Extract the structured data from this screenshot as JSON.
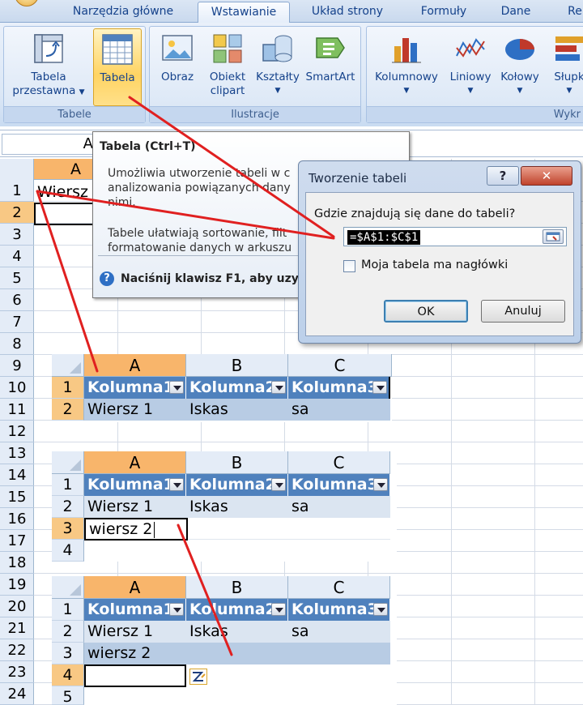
{
  "ribbon": {
    "tabs": [
      "Narzędzia główne",
      "Wstawianie",
      "Układ strony",
      "Formuły",
      "Dane",
      "Re"
    ],
    "active_tab": "Wstawianie",
    "groups": {
      "tabele": {
        "label": "Tabele",
        "pivot_line1": "Tabela",
        "pivot_line2": "przestawna",
        "table": "Tabela"
      },
      "ilustracje": {
        "label": "Ilustracje",
        "picture": "Obraz",
        "clipart_line1": "Obiekt",
        "clipart_line2": "clipart",
        "shapes": "Kształty",
        "smartart": "SmartArt"
      },
      "wykresy": {
        "label": "Wykr",
        "column": "Kolumnowy",
        "line": "Liniowy",
        "pie": "Kołowy",
        "bar": "Słupk"
      }
    }
  },
  "formula_bar": {
    "name_box": "A"
  },
  "sheet": {
    "columns": [
      "A"
    ],
    "row_numbers": [
      "1",
      "2",
      "3",
      "4",
      "5",
      "6",
      "7",
      "8",
      "9",
      "10",
      "11",
      "12",
      "13",
      "14",
      "15",
      "16",
      "17",
      "18",
      "19",
      "20",
      "21",
      "22",
      "23",
      "24"
    ],
    "a1_text": "Wiersz"
  },
  "tooltip": {
    "title": "Tabela (Ctrl+T)",
    "para1_line1": "Umożliwia utworzenie tabeli w c",
    "para1_line2": "analizowania powiązanych dany",
    "para1_line3": "nimi.",
    "para2_line1": "Tabele ułatwiają sortowanie, filt",
    "para2_line2": "formatowanie danych w arkuszu",
    "help": "Naciśnij klawisz F1, aby uzysk"
  },
  "dialog": {
    "title": "Tworzenie tabeli",
    "help_btn": "?",
    "close_btn": "✕",
    "question": "Gdzie znajdują się dane do tabeli?",
    "range": "=$A$1:$C$1",
    "checkbox_label": "Moja tabela ma nagłówki",
    "ok": "OK",
    "cancel": "Anuluj"
  },
  "snapshots": [
    {
      "columns": [
        "A",
        "B",
        "C"
      ],
      "rows": [
        [
          "Kolumna1",
          "Kolumna2",
          "Kolumna3"
        ],
        [
          "Wiersz 1",
          "Iskas",
          "sa"
        ]
      ]
    },
    {
      "columns": [
        "A",
        "B",
        "C"
      ],
      "rows": [
        [
          "Kolumna1",
          "Kolumna2",
          "Kolumna3"
        ],
        [
          "Wiersz 1",
          "Iskas",
          "sa"
        ],
        [
          "wiersz 2",
          "",
          ""
        ],
        [
          "",
          "",
          ""
        ]
      ]
    },
    {
      "columns": [
        "A",
        "B",
        "C"
      ],
      "rows": [
        [
          "Kolumna1",
          "Kolumna2",
          "Kolumna3"
        ],
        [
          "Wiersz 1",
          "Iskas",
          "sa"
        ],
        [
          "wiersz 2",
          "",
          ""
        ],
        [
          "",
          "",
          ""
        ],
        [
          "",
          "",
          ""
        ]
      ]
    }
  ],
  "snapshot_row_numbers": [
    [
      "1",
      "2"
    ],
    [
      "1",
      "2",
      "3",
      "4"
    ],
    [
      "1",
      "2",
      "3",
      "4",
      "5"
    ]
  ],
  "colors": {
    "table_header": "#4f81bd",
    "band_dark": "#b8cce4",
    "band_light": "#dbe5f1",
    "selected_header": "#f8b56b",
    "annotation_arrow": "#e02020"
  },
  "icons": [
    "pivot-table-icon",
    "table-icon",
    "picture-icon",
    "clipart-icon",
    "shapes-icon",
    "smartart-icon",
    "column-chart-icon",
    "line-chart-icon",
    "pie-chart-icon",
    "bar-chart-icon",
    "help-icon",
    "range-picker-icon",
    "autocorrect-options-icon"
  ]
}
